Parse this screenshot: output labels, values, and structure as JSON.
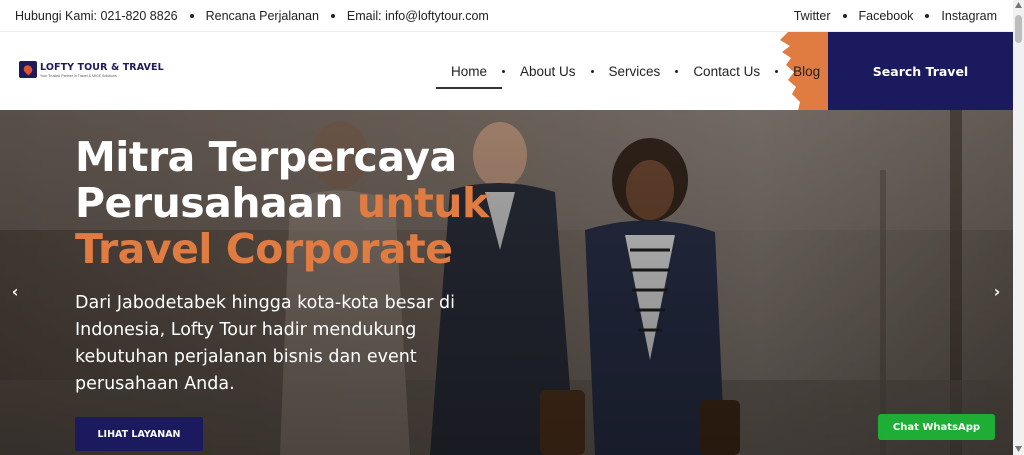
{
  "topbar": {
    "left_items": [
      "Hubungi Kami: 021-820 8826",
      "Rencana Perjalanan",
      "Email: info@loftytour.com"
    ],
    "right_items": [
      "Twitter",
      "Facebook",
      "Instagram"
    ]
  },
  "header": {
    "logo_title": "LOFTY TOUR & TRAVEL",
    "logo_tagline": "Your Trusted Partner in Travel & MICE Solutions",
    "nav": [
      {
        "label": "Home",
        "active": true
      },
      {
        "label": "About Us",
        "active": false
      },
      {
        "label": "Services",
        "active": false
      },
      {
        "label": "Contact Us",
        "active": false
      },
      {
        "label": "Blog",
        "active": false
      }
    ],
    "search_label": "Search Travel"
  },
  "hero": {
    "title_line1": "Mitra Terpercaya",
    "title_line2_a": "Perusahaan ",
    "title_line2_b": "untuk",
    "title_line3": "Travel Corporate",
    "description": "Dari Jabodetabek hingga kota-kota besar di Indonesia, Lofty Tour hadir mendukung kebutuhan perjalanan bisnis dan event perusahaan Anda.",
    "cta_label": "LIHAT LAYANAN",
    "prev_icon": "chevron-left-icon",
    "next_icon": "chevron-right-icon"
  },
  "whatsapp": {
    "label": "Chat WhatsApp"
  },
  "colors": {
    "brand_navy": "#1c1a5e",
    "accent_orange": "#e07b41",
    "whatsapp_green": "#1fae35"
  }
}
